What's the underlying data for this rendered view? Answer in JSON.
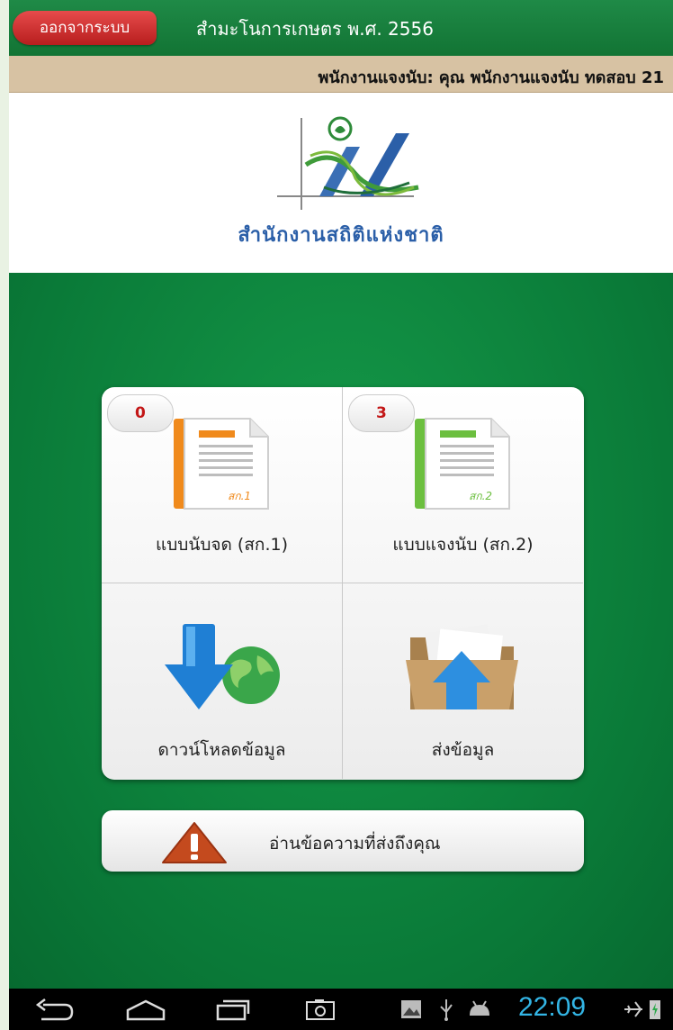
{
  "header": {
    "logout_label": "ออกจากระบบ",
    "app_title": "สำมะโนการเกษตร พ.ศ. 2556"
  },
  "user_bar": {
    "role_label": "พนักงานแจงนับ:",
    "user_name": "คุณ พนักงานแจงนับ ทดสอบ 21"
  },
  "logo": {
    "org_name": "สำนักงานสถิติแห่งชาติ"
  },
  "menu": {
    "items": [
      {
        "label": "แบบนับจด (สก.1)",
        "badge": "0",
        "icon": "form-orange-icon",
        "doc_tag": "สก.1"
      },
      {
        "label": "แบบแจงนับ (สก.2)",
        "badge": "3",
        "icon": "form-green-icon",
        "doc_tag": "สก.2"
      },
      {
        "label": "ดาวน์โหลดข้อมูล",
        "icon": "download-globe-icon"
      },
      {
        "label": "ส่งข้อมูล",
        "icon": "upload-folder-icon"
      }
    ]
  },
  "message_button": {
    "label": "อ่านข้อความที่ส่งถึงคุณ",
    "icon": "warning-icon"
  },
  "system_bar": {
    "time": "22:09"
  },
  "colors": {
    "header_green": "#127434",
    "content_green": "#0b7f3c",
    "logout_red": "#c62828",
    "user_bar": "#d7c2a3",
    "badge_red": "#c31717",
    "clock_blue": "#33b5e5"
  }
}
